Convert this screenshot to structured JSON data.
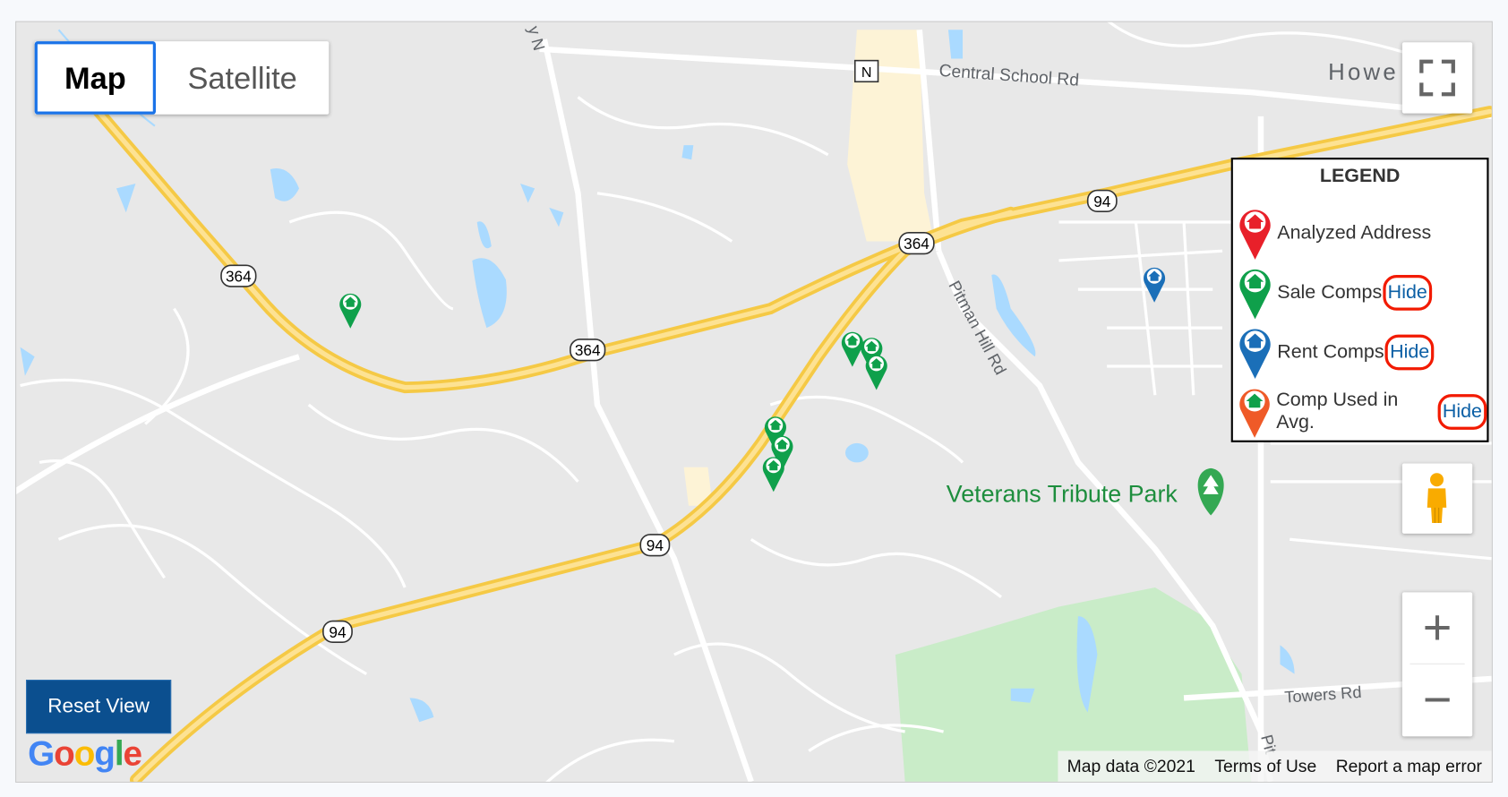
{
  "map_type_control": {
    "map_label": "Map",
    "satellite_label": "Satellite",
    "selected": "Map"
  },
  "map_labels": {
    "central_school_rd": "Central School Rd",
    "howe": "Howe",
    "pitman_hill_rd": "Pitman Hill Rd",
    "veterans_tribute_park": "Veterans Tribute Park",
    "towers_rd": "Towers Rd",
    "north_road": "y N",
    "pitman_bottom": "Pit",
    "route_n": "N",
    "route_364": "364",
    "route_94": "94"
  },
  "legend": {
    "title": "LEGEND",
    "items": [
      {
        "label": "Analyzed Address",
        "color": "#e8202a"
      },
      {
        "label": "Sale Comps",
        "color": "#0fa04b",
        "action": "Hide"
      },
      {
        "label": "Rent Comps",
        "color": "#1b6fb8",
        "action": "Hide"
      },
      {
        "label": "Comp Used in Avg.",
        "color": "#ef5a28",
        "action": "Hide"
      }
    ]
  },
  "controls": {
    "reset_view": "Reset View",
    "zoom_in": "+",
    "zoom_out": "−"
  },
  "logo": "Google",
  "attribution": {
    "map_data": "Map data ©2021",
    "terms": "Terms of Use",
    "report": "Report a map error"
  },
  "colors": {
    "highway": "#fbd66a",
    "water": "#aadaff",
    "park": "#c9ecc8",
    "accent": "#1a73e8",
    "sale": "#0fa04b",
    "rent": "#1b6fb8"
  }
}
